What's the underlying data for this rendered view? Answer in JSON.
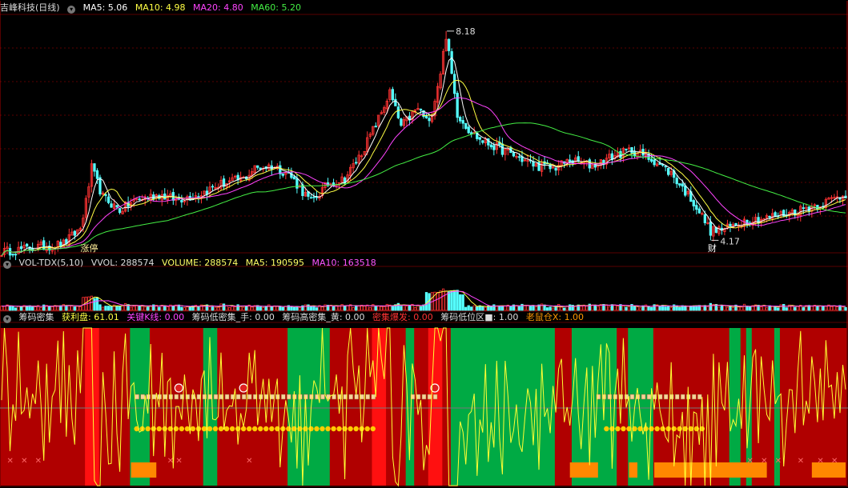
{
  "header": {
    "title": "吉峰科技(日线)",
    "ma": [
      {
        "label": "MA5: 5.06",
        "color": "#ffffff"
      },
      {
        "label": "MA10: 4.98",
        "color": "#ffff44"
      },
      {
        "label": "MA20: 4.80",
        "color": "#ff44ff"
      },
      {
        "label": "MA60: 5.20",
        "color": "#44ee44"
      }
    ]
  },
  "price_annotations": {
    "high": "8.18",
    "low": "4.17",
    "tag_left": "涨停",
    "tag_right": "财"
  },
  "vol_header": {
    "name": "VOL-TDX(5,10)",
    "items": [
      {
        "label": "VVOL: 288574",
        "color": "#dddddd"
      },
      {
        "label": "VOLUME: 288574",
        "color": "#ffff66"
      },
      {
        "label": "MA5: 190595",
        "color": "#ffff66"
      },
      {
        "label": "MA10: 163518",
        "color": "#ff55ff"
      }
    ]
  },
  "chip_header": {
    "name": "筹码密集",
    "items": [
      {
        "label": "获利盘: 61.01",
        "color": "#ffff44"
      },
      {
        "label": "关键K线: 0.00",
        "color": "#ff44ff"
      },
      {
        "label": "筹码低密集_手: 0.00",
        "color": "#dddddd"
      },
      {
        "label": "筹码高密集_黄: 0.00",
        "color": "#dddddd"
      },
      {
        "label": "密集爆发: 0.00",
        "color": "#ff3333"
      },
      {
        "label": "筹码低位区■: 1.00",
        "color": "#dddddd"
      },
      {
        "label": "老鼠仓X: 1.00",
        "color": "#ff9900"
      }
    ]
  },
  "colors": {
    "up": "#ff3333",
    "down": "#55ffff",
    "ma5": "#ffffff",
    "ma10": "#ffff44",
    "ma20": "#ff44ff",
    "ma60": "#44ee44",
    "band_red": "#b00000",
    "band_bright": "#ff1010",
    "band_green": "#00aa44",
    "orange": "#ff8800",
    "profit": "#ffff33"
  },
  "chart_data": {
    "type": "candlestick",
    "title": "吉峰科技(日线)",
    "ylim": [
      3.9,
      8.5
    ],
    "high": 8.18,
    "low": 4.17,
    "ma_last": {
      "MA5": 5.06,
      "MA10": 4.98,
      "MA20": 4.8,
      "MA60": 5.2
    },
    "anchors": [
      [
        0,
        3.95
      ],
      [
        8,
        4.0
      ],
      [
        14,
        4.05
      ],
      [
        22,
        4.1
      ],
      [
        28,
        4.4
      ],
      [
        30,
        4.9
      ],
      [
        32,
        5.55
      ],
      [
        36,
        5.0
      ],
      [
        42,
        4.75
      ],
      [
        48,
        4.95
      ],
      [
        56,
        5.05
      ],
      [
        62,
        4.95
      ],
      [
        70,
        5.05
      ],
      [
        78,
        5.25
      ],
      [
        86,
        5.35
      ],
      [
        90,
        5.55
      ],
      [
        96,
        5.6
      ],
      [
        102,
        5.45
      ],
      [
        110,
        4.9
      ],
      [
        116,
        5.25
      ],
      [
        122,
        5.35
      ],
      [
        128,
        5.85
      ],
      [
        134,
        6.5
      ],
      [
        138,
        7.0
      ],
      [
        142,
        6.35
      ],
      [
        148,
        6.7
      ],
      [
        152,
        6.4
      ],
      [
        156,
        7.4
      ],
      [
        158,
        8.1
      ],
      [
        162,
        6.6
      ],
      [
        166,
        6.3
      ],
      [
        170,
        6.1
      ],
      [
        176,
        5.95
      ],
      [
        182,
        5.8
      ],
      [
        190,
        5.6
      ],
      [
        196,
        5.55
      ],
      [
        202,
        5.7
      ],
      [
        210,
        5.6
      ],
      [
        218,
        5.8
      ],
      [
        224,
        5.9
      ],
      [
        232,
        5.7
      ],
      [
        238,
        5.45
      ],
      [
        246,
        4.9
      ],
      [
        252,
        4.35
      ],
      [
        258,
        4.4
      ],
      [
        264,
        4.55
      ],
      [
        272,
        4.6
      ],
      [
        280,
        4.7
      ],
      [
        290,
        4.85
      ],
      [
        300,
        5.05
      ]
    ],
    "ma_periods": [
      5,
      10,
      20,
      60
    ],
    "volume": {
      "VVOL": 288574,
      "VOLUME": 288574,
      "MA5": 190595,
      "MA10": 163518,
      "ylim": [
        0,
        1200000
      ]
    },
    "chip": {
      "profit_last": 61.01,
      "ylim": [
        0,
        100
      ],
      "bands": [
        [
          0,
          30,
          "red"
        ],
        [
          30,
          35,
          "bright"
        ],
        [
          35,
          46,
          "red"
        ],
        [
          46,
          53,
          "green"
        ],
        [
          53,
          72,
          "red"
        ],
        [
          72,
          77,
          "green"
        ],
        [
          77,
          102,
          "red"
        ],
        [
          102,
          117,
          "green"
        ],
        [
          117,
          132,
          "red"
        ],
        [
          132,
          137,
          "bright"
        ],
        [
          137,
          144,
          "red"
        ],
        [
          144,
          147,
          "green"
        ],
        [
          147,
          152,
          "red"
        ],
        [
          152,
          157,
          "bright"
        ],
        [
          157,
          160,
          "red"
        ],
        [
          160,
          197,
          "green"
        ],
        [
          197,
          203,
          "red"
        ],
        [
          203,
          219,
          "green"
        ],
        [
          219,
          223,
          "red"
        ],
        [
          223,
          232,
          "green"
        ],
        [
          232,
          259,
          "red"
        ],
        [
          259,
          263,
          "green"
        ],
        [
          263,
          265,
          "red"
        ],
        [
          265,
          267,
          "green"
        ],
        [
          267,
          275,
          "red"
        ],
        [
          275,
          277,
          "green"
        ],
        [
          277,
          282,
          "red"
        ],
        [
          282,
          300,
          "red"
        ]
      ],
      "hammer_ranges": [
        [
          48,
          133
        ],
        [
          146,
          155
        ],
        [
          212,
          249
        ]
      ],
      "dot_ranges": [
        [
          48,
          133
        ],
        [
          215,
          249
        ]
      ],
      "balls": [
        63,
        86,
        154
      ],
      "orange_blocks": [
        [
          46,
          55
        ],
        [
          202,
          212
        ],
        [
          223,
          226
        ],
        [
          232,
          272
        ],
        [
          288,
          300
        ]
      ],
      "x_marks": [
        3,
        8,
        13,
        60,
        63,
        88,
        266,
        271,
        276,
        284,
        291,
        296
      ]
    }
  }
}
